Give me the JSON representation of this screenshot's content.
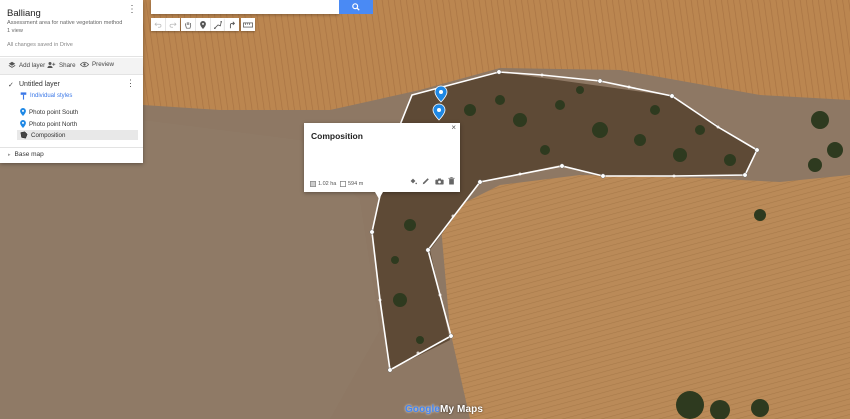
{
  "panel": {
    "map_title": "Balliang",
    "description": "Assessment area for native vegetation method",
    "views": "1 view",
    "save_status": "All changes saved in Drive",
    "actions": [
      {
        "label": "Add layer",
        "icon": "add-layer-icon"
      },
      {
        "label": "Share",
        "icon": "share-icon"
      },
      {
        "label": "Preview",
        "icon": "preview-icon"
      }
    ],
    "layer": {
      "title": "Untitled layer",
      "checked": true,
      "styles_label": "Individual styles",
      "features": [
        {
          "label": "Photo point South",
          "icon": "map-pin-icon",
          "selected": false
        },
        {
          "label": "Photo point North",
          "icon": "map-pin-icon",
          "selected": false
        },
        {
          "label": "Composition",
          "icon": "polygon-icon",
          "selected": true
        }
      ]
    },
    "basemap_label": "Base map"
  },
  "search": {
    "placeholder": "",
    "icon": "search-icon"
  },
  "toolbar": {
    "icons": [
      "undo-icon",
      "redo-icon",
      "pan-hand-icon",
      "add-marker-icon",
      "draw-line-icon",
      "directions-icon",
      "measure-ruler-icon"
    ]
  },
  "infowindow": {
    "title": "Composition",
    "area": "1.02 ha",
    "perimeter": "594 m",
    "tools": [
      "style-paint-icon",
      "edit-pencil-icon",
      "camera-icon",
      "delete-icon"
    ]
  },
  "footer": {
    "logo_google": "Google",
    "logo_mymaps": "My Maps"
  },
  "colors": {
    "accent": "#3b78e7",
    "search_button": "#4a8af4",
    "marker": "#1e88e5",
    "field": "#b8854f",
    "paddock": "#8c7560"
  }
}
